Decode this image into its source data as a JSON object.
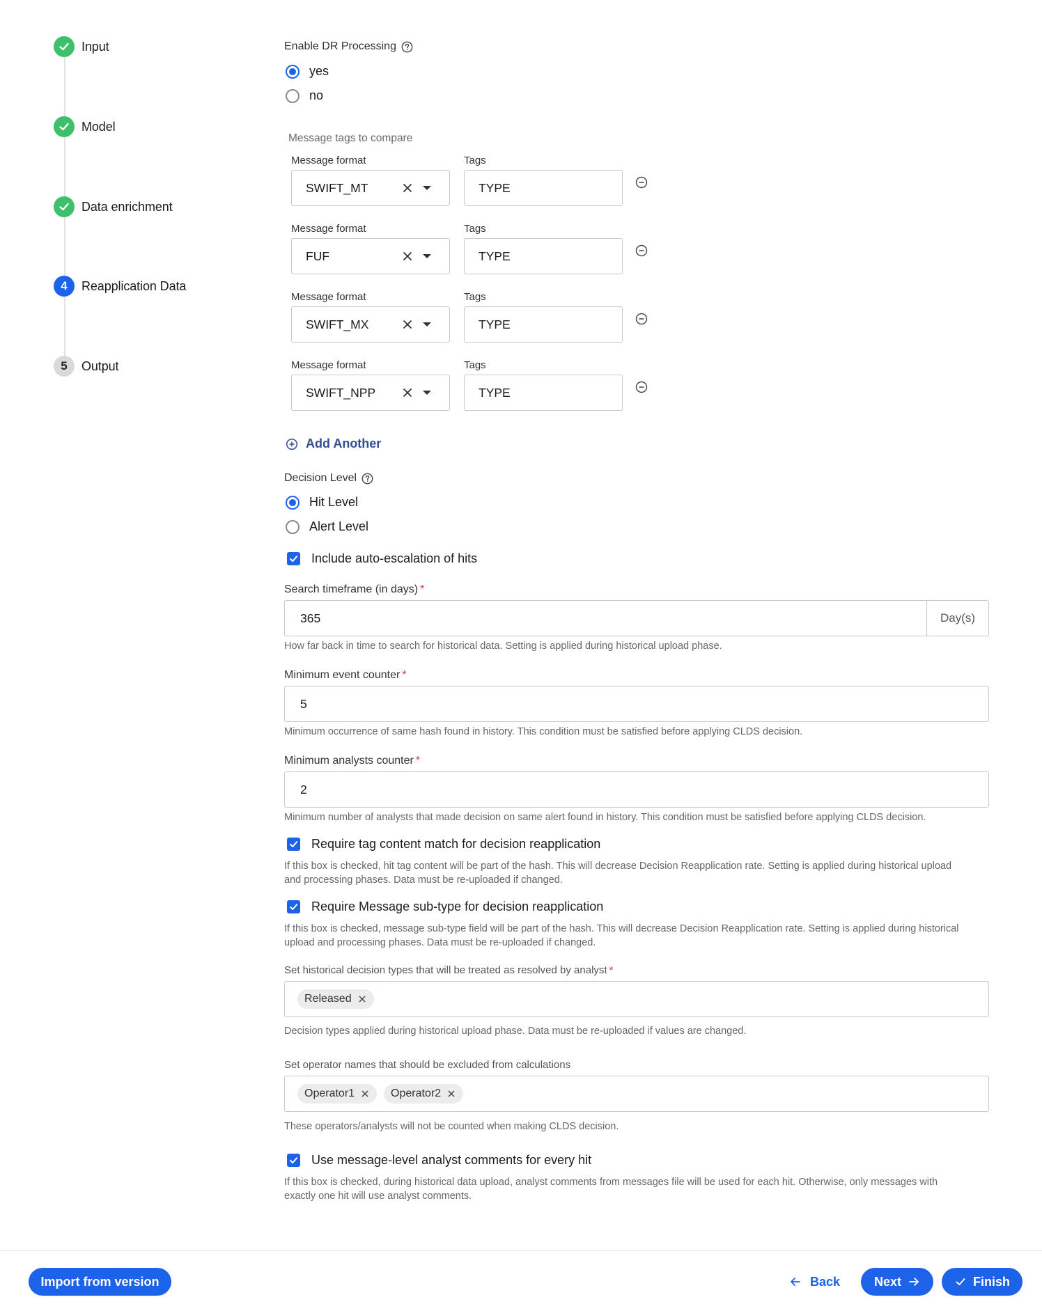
{
  "stepper": {
    "steps": [
      {
        "label": "Input",
        "state": "done",
        "number": ""
      },
      {
        "label": "Model",
        "state": "done",
        "number": ""
      },
      {
        "label": "Data enrichment",
        "state": "done",
        "number": ""
      },
      {
        "label": "Reapplication Data",
        "state": "active",
        "number": "4"
      },
      {
        "label": "Output",
        "state": "todo",
        "number": "5"
      }
    ]
  },
  "dr": {
    "label": "Enable DR Processing",
    "options": [
      {
        "label": "yes",
        "selected": true
      },
      {
        "label": "no",
        "selected": false
      }
    ]
  },
  "tags": {
    "section_label": "Message tags to compare",
    "format_label": "Message format",
    "tags_label": "Tags",
    "rows": [
      {
        "format": "SWIFT_MT",
        "tags": "TYPE"
      },
      {
        "format": "FUF",
        "tags": "TYPE"
      },
      {
        "format": "SWIFT_MX",
        "tags": "TYPE"
      },
      {
        "format": "SWIFT_NPP",
        "tags": "TYPE"
      }
    ],
    "add_label": "Add Another"
  },
  "decision": {
    "label": "Decision Level",
    "options": [
      {
        "label": "Hit Level",
        "selected": true
      },
      {
        "label": "Alert Level",
        "selected": false
      }
    ]
  },
  "auto_escalation": {
    "label": "Include auto-escalation of hits",
    "checked": true
  },
  "timeframe": {
    "label": "Search timeframe (in days)",
    "value": "365",
    "unit": "Day(s)",
    "help": "How far back in time to search for historical data. Setting is applied during historical upload phase."
  },
  "event_counter": {
    "label": "Minimum event counter",
    "value": "5",
    "help": "Minimum occurrence of same hash found in history. This condition must be satisfied before applying CLDS decision."
  },
  "analysts_counter": {
    "label": "Minimum analysts counter",
    "value": "2",
    "help": "Minimum number of analysts that made decision on same alert found in history. This condition must be satisfied before applying CLDS decision."
  },
  "tag_match": {
    "label": "Require tag content match for decision reapplication",
    "checked": true,
    "help_1": "If this box is checked, hit tag content will be part of the hash. This will decrease Decision Reapplication rate. Setting is applied during historical upload",
    "help_2": "and processing phases. Data must be re-uploaded if changed."
  },
  "subtype": {
    "label": "Require Message sub-type for decision reapplication",
    "checked": true,
    "help_1": "If this box is checked, message sub-type field will be part of the hash. This will decrease Decision Reapplication rate. Setting is applied during historical",
    "help_2": "upload and processing phases. Data must be re-uploaded if changed."
  },
  "resolved_types": {
    "label": "Set historical decision types that will be treated as resolved by analyst",
    "chips": [
      "Released"
    ],
    "help": "Decision types applied during historical upload phase. Data must be re-uploaded if values are changed."
  },
  "excluded_operators": {
    "label": "Set operator names that should be excluded from calculations",
    "chips": [
      "Operator1",
      "Operator2"
    ],
    "help": "These operators/analysts will not be counted when making CLDS decision."
  },
  "analyst_comments": {
    "label": "Use message-level analyst comments for every hit",
    "checked": true,
    "help_1": "If this box is checked, during historical data upload, analyst comments from messages file will be used for each hit. Otherwise, only messages with",
    "help_2": "exactly one hit will use analyst comments."
  },
  "footer": {
    "import_label": "Import from version",
    "back_label": "Back",
    "next_label": "Next",
    "finish_label": "Finish"
  },
  "colors": {
    "primary": "#1d63ea",
    "success": "#3fbf6b",
    "required": "#d93a3a"
  }
}
